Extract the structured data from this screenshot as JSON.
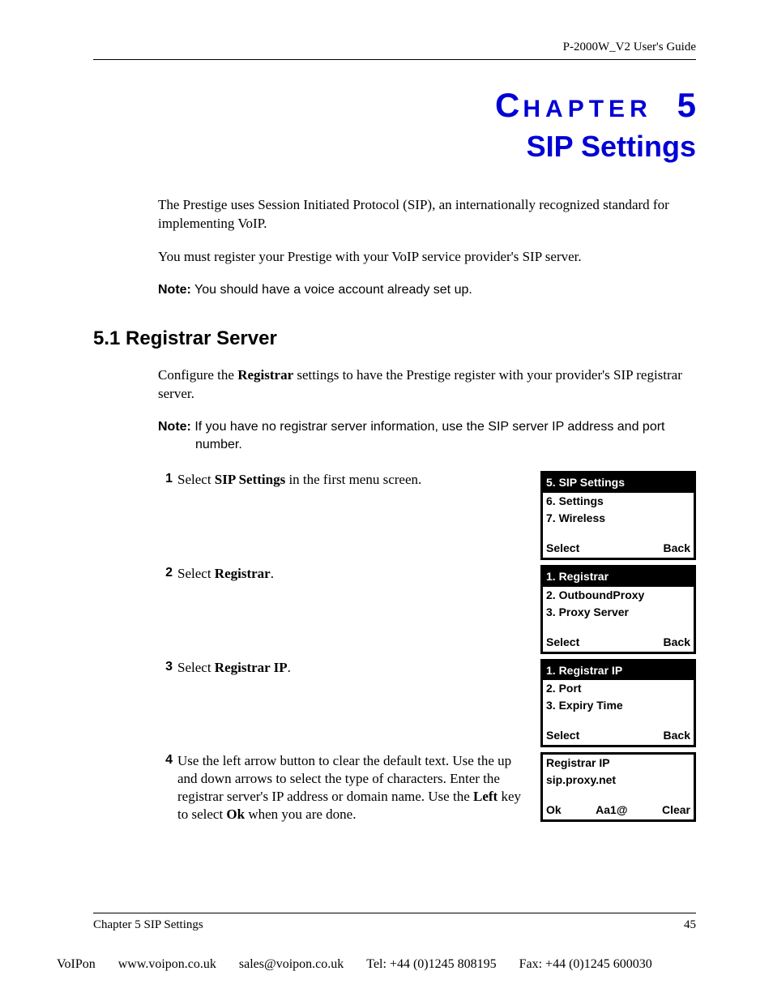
{
  "header": {
    "guide_title": "P-2000W_V2 User's Guide"
  },
  "chapter": {
    "label_first": "C",
    "label_rest": "HAPTER",
    "number": "5",
    "title": "SIP Settings"
  },
  "intro": {
    "p1": "The Prestige uses Session Initiated Protocol (SIP), an internationally recognized standard for implementing VoIP.",
    "p2": "You must register your Prestige with your VoIP service provider's SIP server.",
    "note_label": "Note:",
    "note_text": " You should have a voice account already set up."
  },
  "section": {
    "heading": "5.1  Registrar Server",
    "p1a": "Configure the ",
    "p1b": "Registrar",
    "p1c": " settings to have the Prestige register with your provider's SIP registrar server.",
    "note_label": "Note:",
    "note_text": " If you have no registrar server information, use the SIP server IP address and port number."
  },
  "steps": [
    {
      "num": "1",
      "parts": [
        "Select ",
        "SIP Settings",
        " in the first menu screen."
      ],
      "screen": {
        "highlight": "5. SIP Settings",
        "lines": [
          "6. Settings",
          "7. Wireless"
        ],
        "footer": [
          "Select",
          "Back"
        ]
      }
    },
    {
      "num": "2",
      "parts": [
        "Select ",
        "Registrar",
        "."
      ],
      "screen": {
        "highlight": "1. Registrar",
        "lines": [
          "2. OutboundProxy",
          "3. Proxy Server"
        ],
        "footer": [
          "Select",
          "Back"
        ]
      }
    },
    {
      "num": "3",
      "parts": [
        "Select ",
        "Registrar IP",
        "."
      ],
      "screen": {
        "highlight": "1. Registrar IP",
        "lines": [
          "2. Port",
          "3. Expiry Time"
        ],
        "footer": [
          "Select",
          "Back"
        ]
      }
    },
    {
      "num": "4",
      "parts": [
        "Use the left arrow button to clear the default text. Use the up and down arrows to select the type of characters. Enter the registrar server's IP address or domain name. Use the ",
        "Left",
        " key to select ",
        "Ok",
        " when you are done."
      ],
      "screen": {
        "lines": [
          "Registrar IP",
          "sip.proxy.net"
        ],
        "footer3": [
          "Ok",
          "Aa1@",
          "Clear"
        ]
      }
    }
  ],
  "footer": {
    "left": "Chapter 5 SIP Settings",
    "right": "45"
  },
  "bottom": {
    "company": "VoIPon",
    "url": "www.voipon.co.uk",
    "email": "sales@voipon.co.uk",
    "tel": "Tel: +44 (0)1245 808195",
    "fax": "Fax: +44 (0)1245 600030"
  }
}
